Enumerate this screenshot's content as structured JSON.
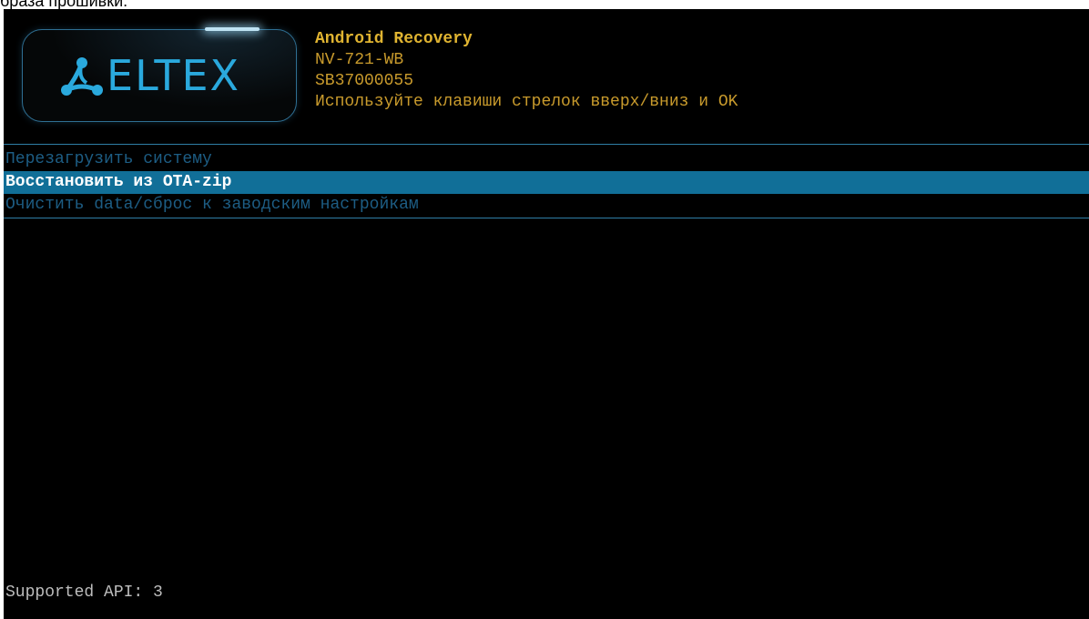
{
  "caption": "браза прошивки.",
  "logo": {
    "text": "ELTEX",
    "icon": "eltex-logo-icon",
    "color": "#2aa9dd"
  },
  "header": {
    "title": "Android Recovery",
    "model": "NV-721-WB",
    "serial": "SB37000055",
    "hint": "Используйте клавиши стрелок вверх/вниз и OK"
  },
  "menu": {
    "items": [
      {
        "label": "Перезагрузить систему",
        "selected": false
      },
      {
        "label": "Восстановить из OTA-zip",
        "selected": true
      },
      {
        "label": "Очистить data/сброс к заводским настройкам",
        "selected": false
      }
    ]
  },
  "footer": {
    "status": "Supported API: 3"
  },
  "colors": {
    "background": "#000000",
    "accent": "#116f98",
    "header_text": "#c89a2c",
    "menu_text": "#1d5d84"
  }
}
